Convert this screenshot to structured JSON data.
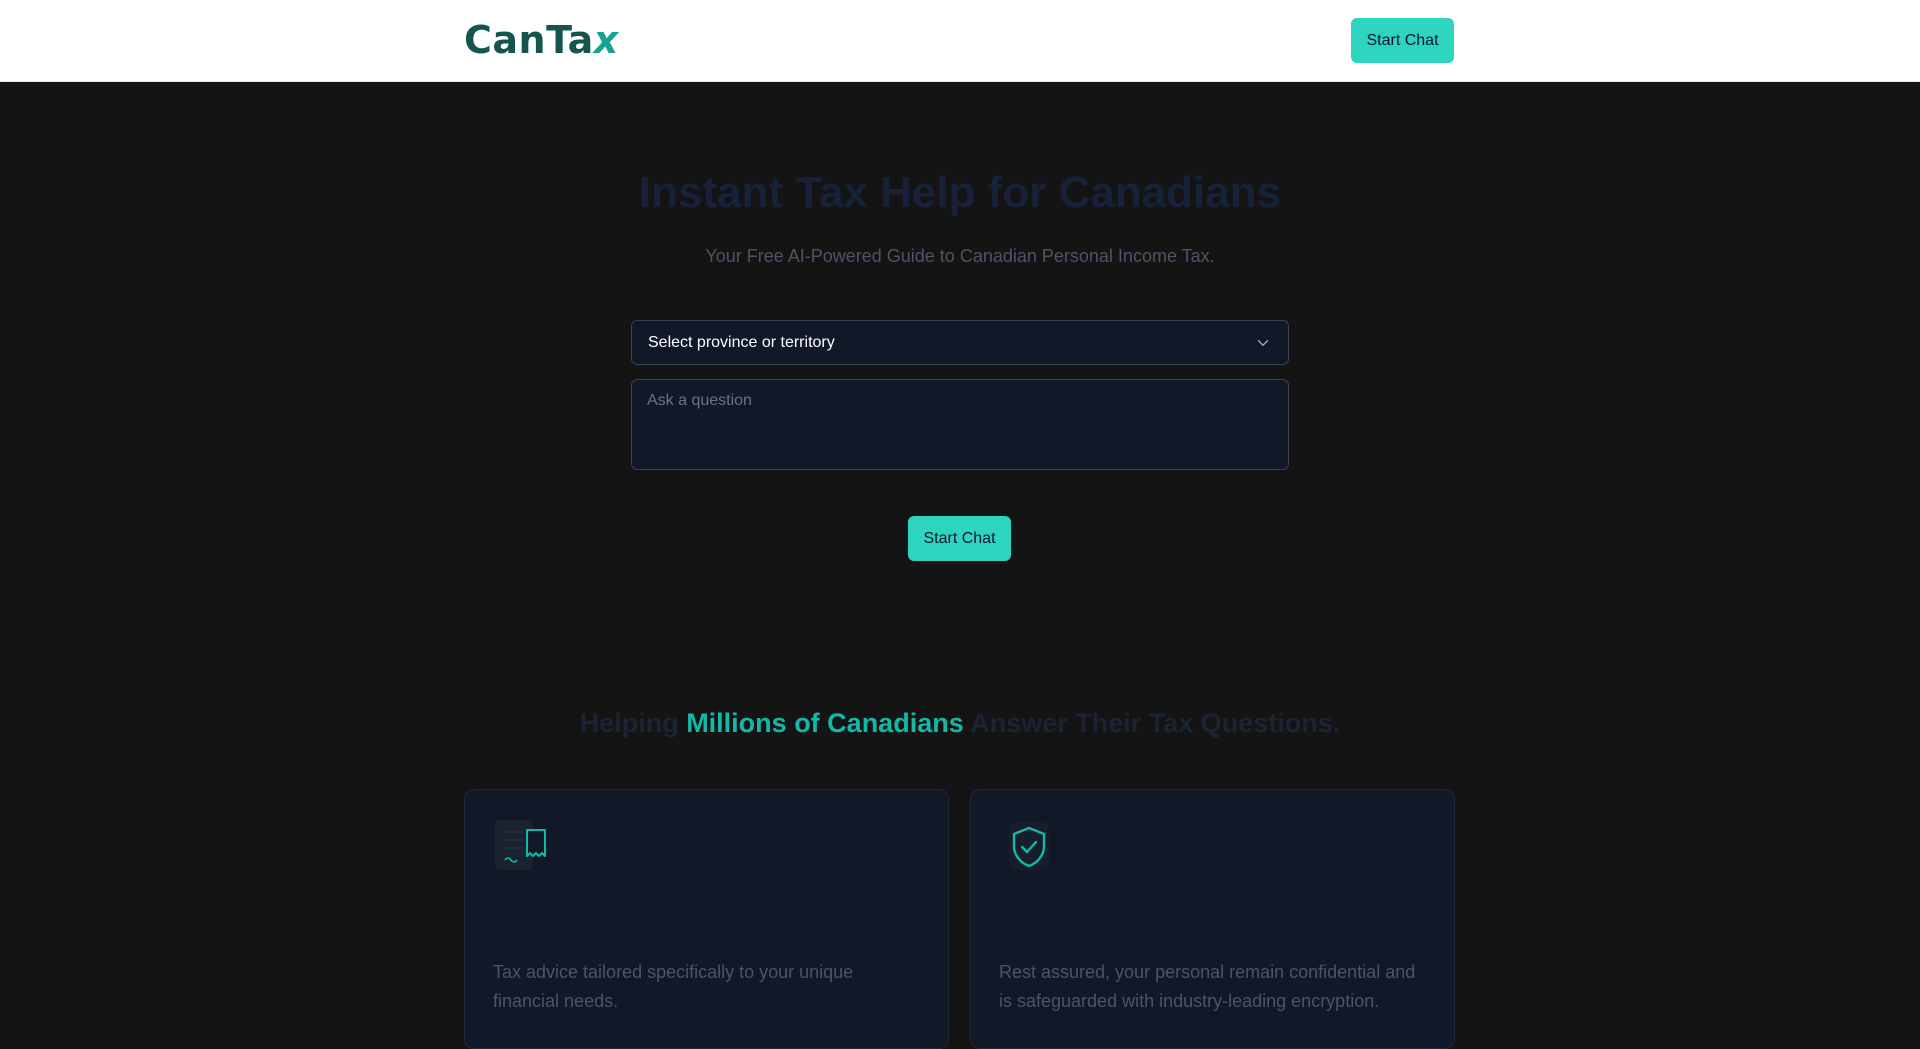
{
  "header": {
    "logo_text": "CanTa",
    "logo_accent": "x",
    "start_chat_label": "Start Chat"
  },
  "hero": {
    "title": "Instant Tax Help for Canadians",
    "subtitle": "Your Free AI-Powered Guide to Canadian Personal Income Tax.",
    "province_select_value": "Select province or territory",
    "question_placeholder": "Ask a question",
    "start_chat_label": "Start Chat"
  },
  "section": {
    "title_prefix": "Helping ",
    "title_highlight": "Millions of Canadians",
    "title_suffix": " Answer Their Tax Questions."
  },
  "cards": [
    {
      "icon": "receipt-document-icon",
      "text": "Tax advice tailored specifically to your unique financial needs."
    },
    {
      "icon": "shield-check-icon",
      "text": "Rest assured, your personal remain confidential and is safeguarded with industry-leading encryption."
    }
  ],
  "colors": {
    "accent": "#2dd4bf",
    "logo": "#14554e",
    "background": "#141414",
    "card": "#111827"
  }
}
